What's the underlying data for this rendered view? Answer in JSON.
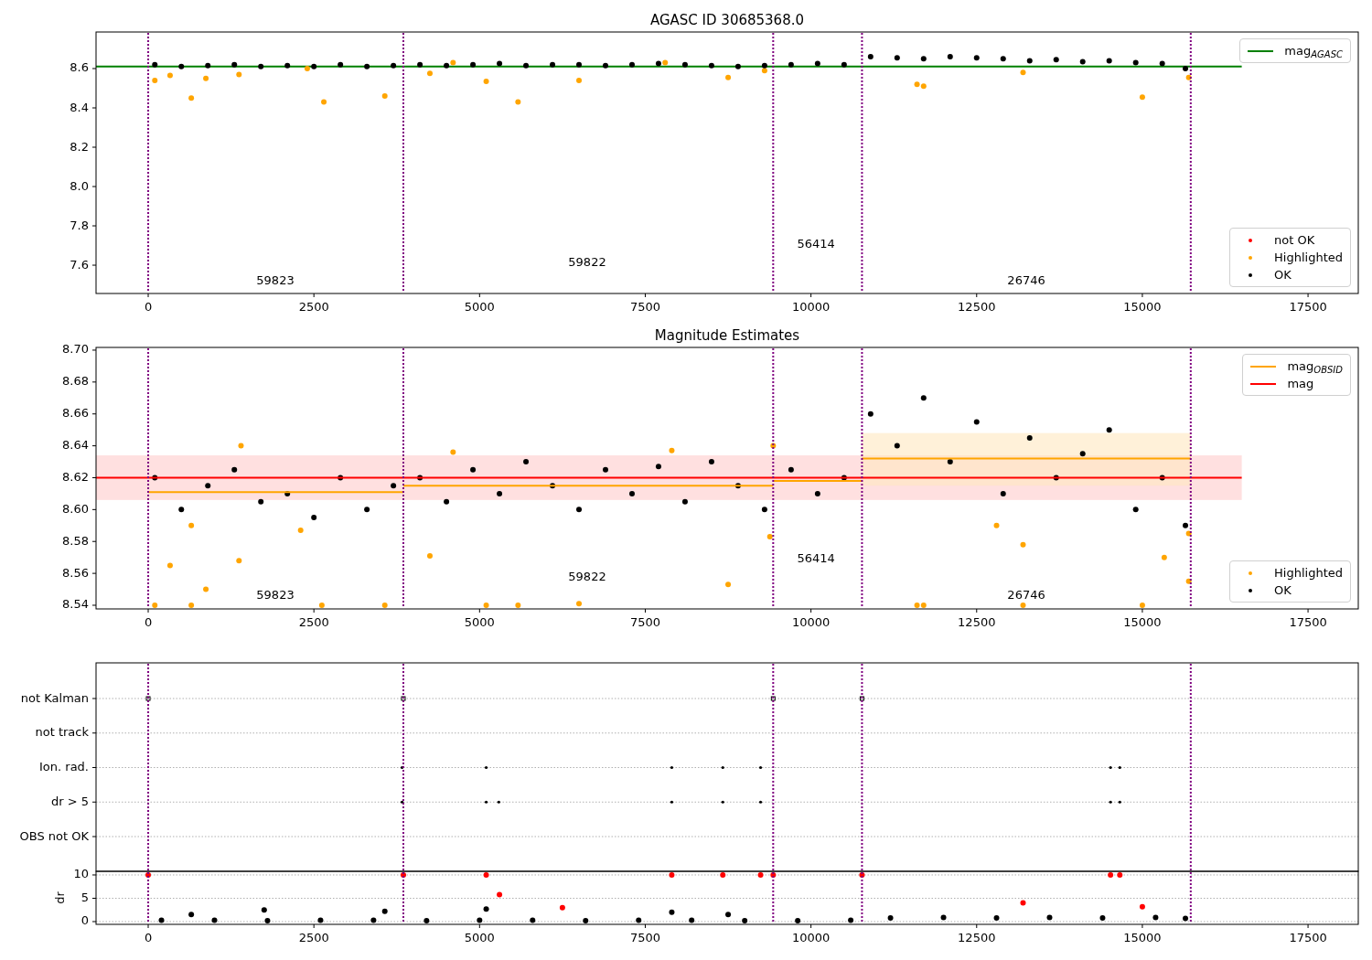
{
  "panels": [
    {
      "legends": [
        {
          "entries": [
            {
              "label": "mag$_{AGASC}$",
              "color": "#008000",
              "kind": "line"
            }
          ]
        },
        {
          "entries": [
            {
              "label": "not OK",
              "color": "#ff0000",
              "kind": "point"
            },
            {
              "label": "Highlighted",
              "color": "#ffa500",
              "kind": "point"
            },
            {
              "label": "OK",
              "color": "#000000",
              "kind": "point"
            }
          ]
        }
      ],
      "chart_data": {
        "type": "scatter",
        "title": "AGASC ID 30685368.0",
        "xlim": [
          -787,
          18258
        ],
        "ylim": [
          7.456,
          8.786
        ],
        "xticks": [
          0,
          2500,
          5000,
          7500,
          10000,
          12500,
          15000,
          17500
        ],
        "yticks": [
          {
            "value": 7.6,
            "label": "7.6"
          },
          {
            "value": 7.8,
            "label": "7.8"
          },
          {
            "value": 8.0,
            "label": "8.0"
          },
          {
            "value": 8.2,
            "label": "8.2"
          },
          {
            "value": 8.4,
            "label": "8.4"
          },
          {
            "value": 8.6,
            "label": "8.6"
          }
        ],
        "series": [
          {
            "color": "#008000",
            "type": "line",
            "marker": "none",
            "x": [
              -787,
              16500
            ],
            "values": [
              8.61,
              8.61
            ]
          },
          {
            "color": "#ffa500",
            "marker": "circle",
            "x": [
              100,
              330,
              650,
              870,
              1370,
              2650,
              3570,
              4250,
              5100,
              5580,
              6500,
              8750,
              11600,
              11700,
              13200,
              15000,
              15700,
              2400,
              4600,
              7800,
              9300
            ],
            "values": [
              8.54,
              8.565,
              8.45,
              8.55,
              8.57,
              8.43,
              8.46,
              8.575,
              8.535,
              8.43,
              8.54,
              8.555,
              8.52,
              8.51,
              8.58,
              8.455,
              8.555,
              8.6,
              8.63,
              8.63,
              8.59
            ]
          },
          {
            "color": "#000000",
            "marker": "circle",
            "x": [
              100,
              500,
              900,
              1300,
              1700,
              2100,
              2500,
              2900,
              3300,
              3700,
              4100,
              4500,
              4900,
              5300,
              5700,
              6100,
              6500,
              6900,
              7300,
              7700,
              8100,
              8500,
              8900,
              9300,
              9700,
              10100,
              10500,
              10900,
              11300,
              11700,
              12100,
              12500,
              12900,
              13300,
              13700,
              14100,
              14500,
              14900,
              15300,
              15650
            ],
            "values": [
              8.62,
              8.61,
              8.615,
              8.62,
              8.61,
              8.615,
              8.61,
              8.62,
              8.61,
              8.615,
              8.62,
              8.615,
              8.62,
              8.625,
              8.615,
              8.62,
              8.62,
              8.615,
              8.62,
              8.625,
              8.62,
              8.615,
              8.61,
              8.615,
              8.62,
              8.625,
              8.62,
              8.66,
              8.655,
              8.65,
              8.66,
              8.655,
              8.65,
              8.64,
              8.645,
              8.635,
              8.64,
              8.63,
              8.625,
              8.6
            ]
          }
        ],
        "ref_lines": [
          {
            "axis": "x",
            "value": 0
          },
          {
            "axis": "x",
            "value": 3850
          },
          {
            "axis": "x",
            "value": 9430
          },
          {
            "axis": "x",
            "value": 10770
          },
          {
            "axis": "x",
            "value": 15730
          }
        ],
        "annotations": [
          "59823",
          "59822",
          "56414",
          "26746"
        ]
      }
    },
    {
      "legends": [
        {
          "entries": [
            {
              "label": "mag$_{OBSID}$",
              "color": "#ffa500",
              "kind": "line"
            },
            {
              "label": "mag",
              "color": "#ff0000",
              "kind": "line"
            }
          ]
        },
        {
          "entries": [
            {
              "label": "Highlighted",
              "color": "#ffa500",
              "kind": "point"
            },
            {
              "label": "OK",
              "color": "#000000",
              "kind": "point"
            }
          ]
        }
      ],
      "chart_data": {
        "type": "scatter",
        "title": "Magnitude Estimates",
        "xlim": [
          -787,
          18258
        ],
        "ylim": [
          8.5377,
          8.7017
        ],
        "xticks": [
          0,
          2500,
          5000,
          7500,
          10000,
          12500,
          15000,
          17500
        ],
        "yticks": [
          {
            "value": 8.54,
            "label": "8.54"
          },
          {
            "value": 8.56,
            "label": "8.56"
          },
          {
            "value": 8.58,
            "label": "8.58"
          },
          {
            "value": 8.6,
            "label": "8.60"
          },
          {
            "value": 8.62,
            "label": "8.62"
          },
          {
            "value": 8.64,
            "label": "8.64"
          },
          {
            "value": 8.66,
            "label": "8.66"
          },
          {
            "value": 8.68,
            "label": "8.68"
          },
          {
            "value": 8.7,
            "label": "8.70"
          }
        ],
        "series": [
          {
            "color": "#ffa500",
            "marker": "circle",
            "x": [
              100,
              650,
              330,
              870,
              1370,
              650,
              2300,
              2620,
              3570,
              4250,
              5100,
              5580,
              6500,
              8750,
              9380,
              1400,
              4600,
              7900,
              9430,
              12800,
              13200,
              11600,
              11700,
              13200,
              15000,
              15330,
              15700,
              15700
            ],
            "values": [
              8.54,
              8.54,
              8.565,
              8.55,
              8.568,
              8.59,
              8.587,
              8.54,
              8.54,
              8.571,
              8.54,
              8.54,
              8.541,
              8.553,
              8.583,
              8.64,
              8.636,
              8.637,
              8.64,
              8.59,
              8.578,
              8.54,
              8.54,
              8.54,
              8.54,
              8.57,
              8.555,
              8.585
            ]
          },
          {
            "color": "#000000",
            "marker": "circle",
            "x": [
              100,
              500,
              900,
              1300,
              1700,
              2100,
              2500,
              2900,
              3300,
              3700,
              4100,
              4500,
              4900,
              5300,
              5700,
              6100,
              6500,
              6900,
              7300,
              7700,
              8100,
              8500,
              8900,
              9300,
              9700,
              10100,
              10500,
              10900,
              11300,
              11700,
              12100,
              12500,
              12900,
              13300,
              13700,
              14100,
              14500,
              14900,
              15300,
              15650
            ],
            "values": [
              8.62,
              8.6,
              8.615,
              8.625,
              8.605,
              8.61,
              8.595,
              8.62,
              8.6,
              8.615,
              8.62,
              8.605,
              8.625,
              8.61,
              8.63,
              8.615,
              8.6,
              8.625,
              8.61,
              8.627,
              8.605,
              8.63,
              8.615,
              8.6,
              8.625,
              8.61,
              8.62,
              8.66,
              8.64,
              8.67,
              8.63,
              8.655,
              8.61,
              8.645,
              8.62,
              8.635,
              8.65,
              8.6,
              8.62,
              8.59
            ]
          },
          {
            "color": "#ffa500",
            "type": "line",
            "marker": "none",
            "x": [
              0,
              3850,
              null,
              3850,
              9430,
              null,
              9430,
              10770,
              null,
              10770,
              15730
            ],
            "values": [
              8.611,
              8.611,
              null,
              8.615,
              8.615,
              null,
              8.618,
              8.618,
              null,
              8.632,
              8.632
            ]
          },
          {
            "color": "#ff0000",
            "type": "line",
            "marker": "none",
            "x": [
              -787,
              16500
            ],
            "values": [
              8.62,
              8.62
            ]
          }
        ],
        "bands": [
          {
            "axis": "y",
            "from": 8.606,
            "to": 8.634,
            "color": "#ffcccc"
          },
          {
            "axis": "y",
            "from": 8.615,
            "to": 8.648,
            "color": "#ffe8c0"
          }
        ],
        "ref_lines": [
          {
            "axis": "x",
            "value": 0
          },
          {
            "axis": "x",
            "value": 3850
          },
          {
            "axis": "x",
            "value": 9430
          },
          {
            "axis": "x",
            "value": 10770
          },
          {
            "axis": "x",
            "value": 15730
          }
        ],
        "annotations": [
          "59823",
          "59822",
          "56414",
          "26746"
        ]
      }
    },
    {
      "row_labels": [
        "not Kalman",
        "not track",
        "Ion. rad.",
        "dr > 5",
        "OBS not OK"
      ]
    },
    {
      "chart_data": {
        "type": "scatter",
        "ylabel": "dr",
        "grid": true,
        "xlim": [
          -787,
          18258
        ],
        "ylim": [
          -0.59,
          10.78
        ],
        "xticks": [
          0,
          2500,
          5000,
          7500,
          10000,
          12500,
          15000,
          17500
        ],
        "yticks": [
          0,
          5,
          10
        ],
        "series": [
          {
            "color": "#ff0000",
            "marker": "circle",
            "x": [
              0,
              3850,
              9430,
              10770,
              5100,
              7900,
              8670,
              9240,
              14520,
              14660,
              5300,
              6250,
              13200,
              15000
            ],
            "values": [
              10,
              10,
              10,
              10,
              10,
              10,
              10,
              10,
              10,
              10,
              5.8,
              3,
              4,
              3.2
            ]
          },
          {
            "color": "#000000",
            "marker": "circle",
            "x": [
              200,
              1000,
              1800,
              2600,
              3400,
              4200,
              5000,
              5800,
              6600,
              7400,
              8200,
              9000,
              9800,
              10600,
              11200,
              12000,
              12800,
              13600,
              14400,
              15200,
              15650,
              650,
              1750,
              3570,
              5100,
              7900,
              8750
            ],
            "values": [
              0.3,
              0.3,
              0.2,
              0.3,
              0.3,
              0.2,
              0.3,
              0.3,
              0.2,
              0.3,
              0.3,
              0.2,
              0.2,
              0.3,
              0.8,
              0.9,
              0.8,
              0.9,
              0.8,
              0.9,
              0.7,
              1.5,
              2.5,
              2.2,
              2.7,
              2,
              1.5
            ]
          }
        ],
        "ref_lines": [
          {
            "axis": "x",
            "value": 0
          },
          {
            "axis": "x",
            "value": 3850
          },
          {
            "axis": "x",
            "value": 9430
          },
          {
            "axis": "x",
            "value": 10770
          },
          {
            "axis": "x",
            "value": 15730
          }
        ]
      }
    }
  ]
}
